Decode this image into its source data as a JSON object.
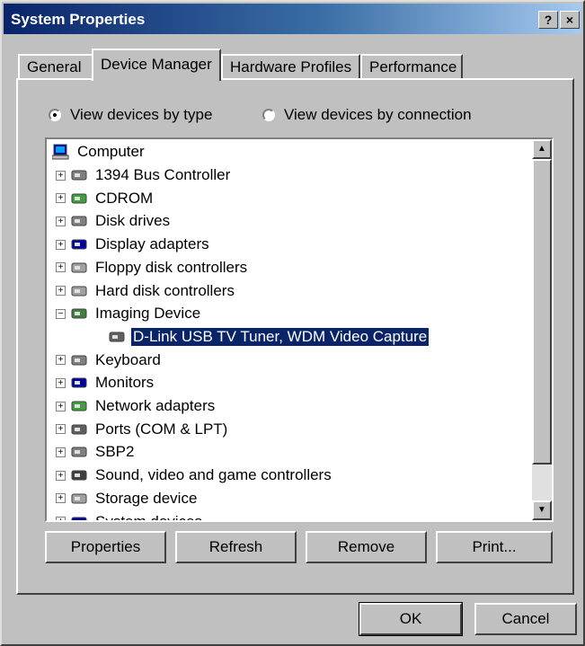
{
  "window": {
    "title": "System Properties",
    "help_glyph": "?",
    "close_glyph": "×"
  },
  "tabs": [
    "General",
    "Device Manager",
    "Hardware Profiles",
    "Performance"
  ],
  "view": {
    "by_type": "View devices by type",
    "by_connection": "View devices by connection"
  },
  "tree": {
    "root": "Computer",
    "items": [
      "1394 Bus Controller",
      "CDROM",
      "Disk drives",
      "Display adapters",
      "Floppy disk controllers",
      "Hard disk controllers",
      "Imaging Device",
      "D-Link USB TV Tuner, WDM Video Capture",
      "Keyboard",
      "Monitors",
      "Network adapters",
      "Ports (COM & LPT)",
      "SBP2",
      "Sound, video and game controllers",
      "Storage device",
      "System devices"
    ],
    "selected": "D-Link USB TV Tuner, WDM Video Capture"
  },
  "buttons": {
    "properties": "Properties",
    "refresh": "Refresh",
    "remove": "Remove",
    "print": "Print...",
    "ok": "OK",
    "cancel": "Cancel"
  },
  "colors": {
    "face": "#c0c0c0",
    "selection": "#0a246a",
    "title_start": "#0a246a",
    "title_end": "#a6caf0"
  }
}
